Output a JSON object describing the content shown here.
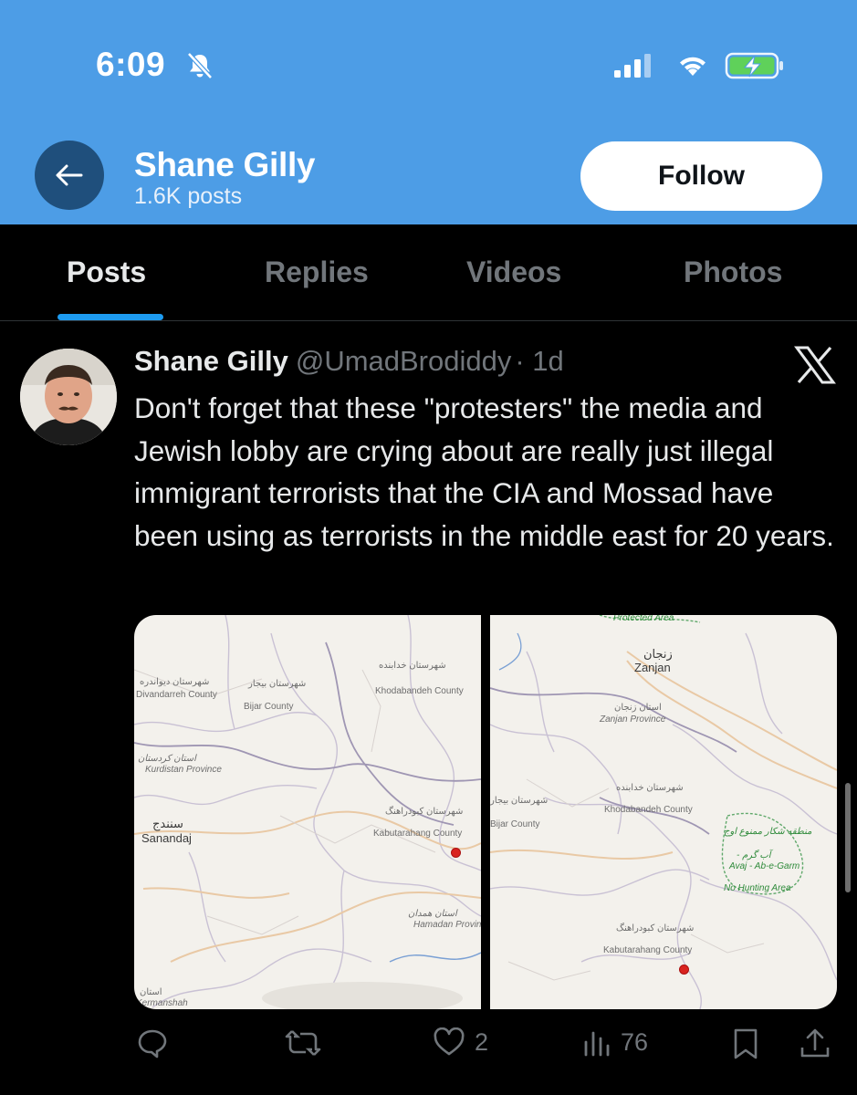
{
  "status_bar": {
    "time": "6:09"
  },
  "header": {
    "name": "Shane Gilly",
    "post_count": "1.6K posts",
    "follow_label": "Follow"
  },
  "tabs": [
    {
      "label": "Posts",
      "active": true
    },
    {
      "label": "Replies",
      "active": false
    },
    {
      "label": "Videos",
      "active": false
    },
    {
      "label": "Photos",
      "active": false
    }
  ],
  "post": {
    "author": "Shane Gilly",
    "handle": "@UmadBrodiddy",
    "time": "· 1d",
    "text": "Don't forget that these \"protesters\" the media and Jewish lobby are crying about are really just illegal immigrant terrorists that the CIA and Mossad have been using as terrorists in the middle east for 20 years.",
    "map_left": {
      "labels": [
        "شهرستان دیواندره",
        "Divandarreh County",
        "شهرستان بیجار",
        "Bijar County",
        "شهرستان خدابنده",
        "Khodabandeh County",
        "استان کردستان",
        "Kurdistan Province",
        "سنندج",
        "Sanandaj",
        "شهرستان کبودراهنگ",
        "Kabutarahang County",
        "استان همدان",
        "Hamadan Province",
        "استان",
        "Kermanshah"
      ]
    },
    "map_right": {
      "labels": [
        "Protected Area",
        "زنجان",
        "Zanjan",
        "استان زنجان",
        "Zanjan Province",
        "شهرستان بیجار",
        "Bijar County",
        "شهرستان خدابنده",
        "Khodabandeh County",
        "منطقه شکار ممنوع اوج",
        "- آب گرم",
        "Avaj - Ab-e-Garm",
        "No Hunting Area",
        "شهرستان کبودراهنگ",
        "Kabutarahang County"
      ]
    },
    "stats": {
      "replies": "",
      "reposts": "",
      "likes": "2",
      "views": "76"
    }
  },
  "colors": {
    "header_bg": "#4d9de6",
    "accent": "#1d9bf0",
    "map_bg": "#f3f1ec",
    "marker": "#d9231f"
  }
}
